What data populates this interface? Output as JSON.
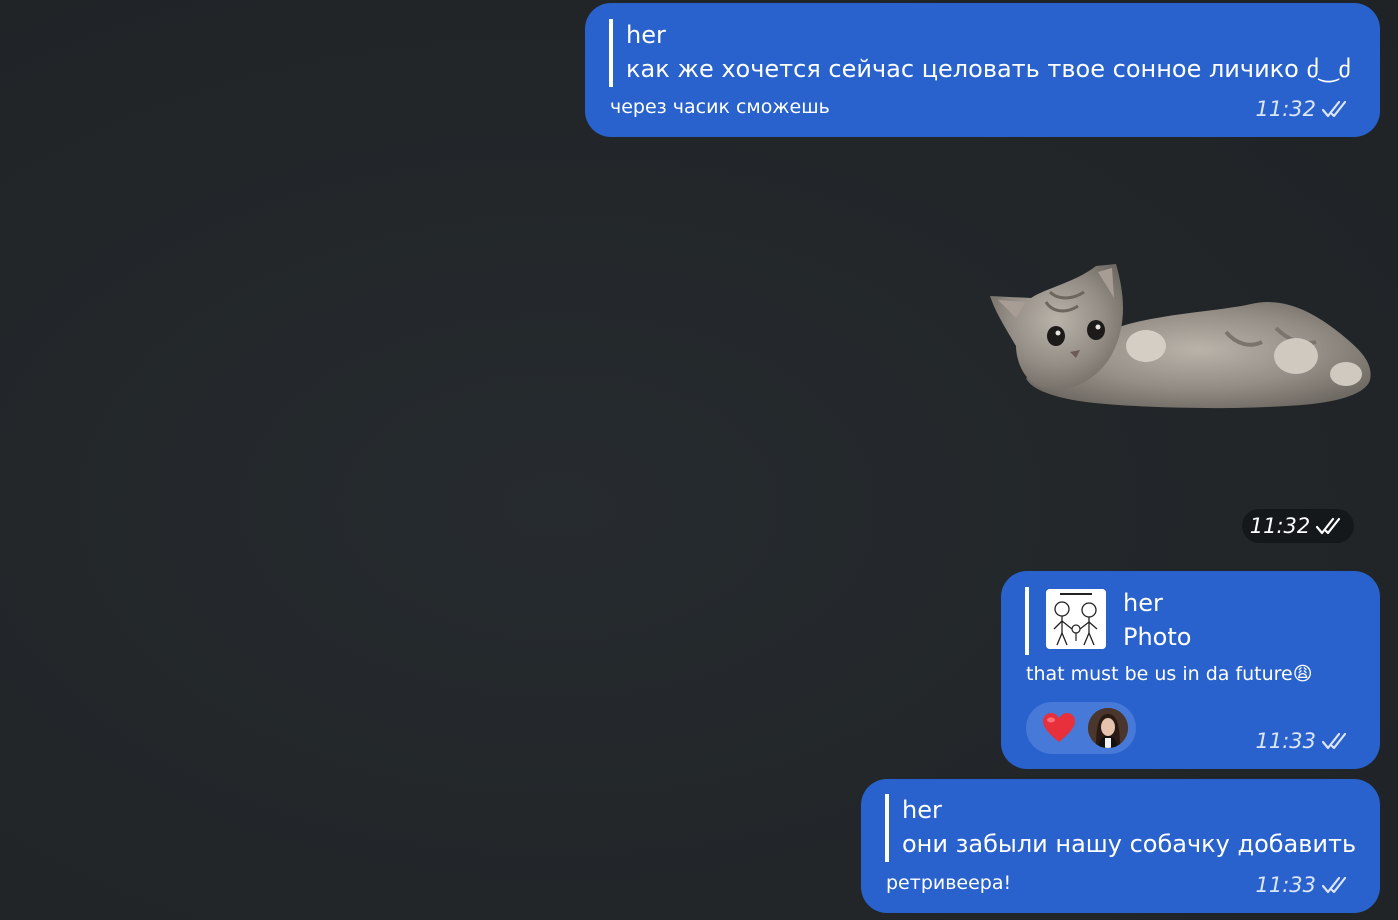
{
  "messages": [
    {
      "reply_name": "her",
      "reply_text": "как же хочется сейчас целовать твое сонное личико ძ‿ძ",
      "text": "через часик сможешь",
      "time": "11:32"
    },
    {
      "sticker_icon": "kitten-sticker",
      "time": "11:32"
    },
    {
      "reply_name": "her",
      "reply_text": "Photo",
      "reply_thumb_icon": "stick-figure-family-thumbnail",
      "text": "that must be us in da future😩",
      "reaction_icon": "heart",
      "reaction_avatar_icon": "user-avatar",
      "time": "11:33"
    },
    {
      "reply_name": "her",
      "reply_text": "они забыли нашу собачку добавить",
      "text": "ретривеера!",
      "time": "11:33"
    }
  ],
  "colors": {
    "background": "#23272b",
    "bubble": "#2962cc",
    "reaction_pill": "#4679d8",
    "heart": "#e8303c"
  }
}
